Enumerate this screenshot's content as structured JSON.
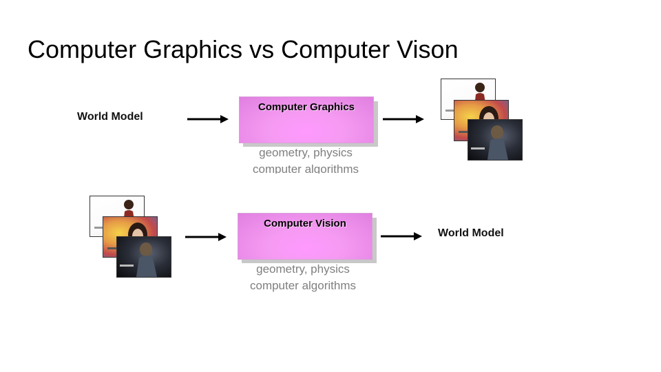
{
  "slide": {
    "title": "Computer Graphics vs Computer Vison"
  },
  "top_row": {
    "input_label": "World Model",
    "box_label": "Computer Graphics",
    "box_subtitle_line1": "geometry, physics",
    "box_subtitle_line2": "computer algorithms"
  },
  "bottom_row": {
    "box_label": "Computer Vision",
    "box_subtitle_line1": "geometry, physics",
    "box_subtitle_line2": "computer algorithms",
    "output_label": "World Model"
  },
  "colors": {
    "box_fill": "#f59af2",
    "subtitle_text": "#7f7f7f",
    "arrow": "#000000"
  }
}
